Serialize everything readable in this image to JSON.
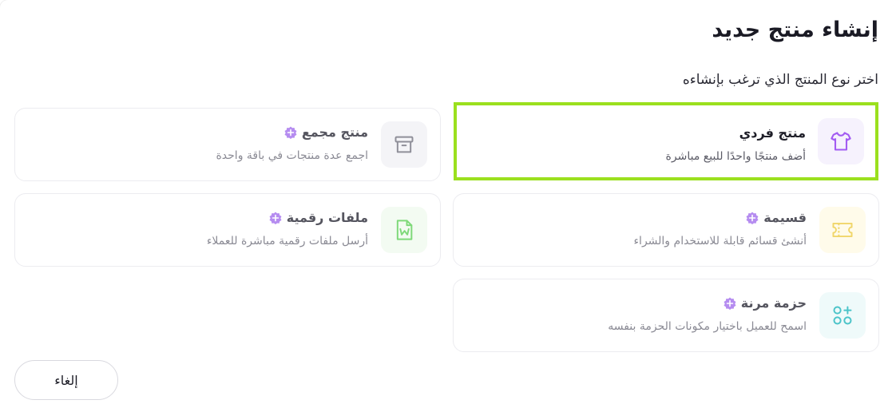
{
  "dialog": {
    "title": "إنشاء منتج جديد",
    "subtitle": "اختر نوع المنتج الذي ترغب بإنشاءه"
  },
  "options": [
    {
      "title": "منتج فردي",
      "description": "أضف منتجًا واحدًا للبيع مباشرة",
      "icon": "tshirt-icon",
      "selected": true,
      "badge": false
    },
    {
      "title": "منتج مجمع",
      "description": "اجمع عدة منتجات في باقة واحدة",
      "icon": "archive-box-icon",
      "selected": false,
      "badge": true
    },
    {
      "title": "قسيمة",
      "description": "أنشئ قسائم قابلة للاستخدام والشراء",
      "icon": "ticket-icon",
      "selected": false,
      "badge": true
    },
    {
      "title": "ملفات رقمية",
      "description": "أرسل ملفات رقمية مباشرة للعملاء",
      "icon": "document-icon",
      "selected": false,
      "badge": true
    },
    {
      "title": "حزمة مرنة",
      "description": "اسمح للعميل باختيار مكونات الحزمة بنفسه",
      "icon": "shapes-plus-icon",
      "selected": false,
      "badge": true
    }
  ],
  "footer": {
    "cancel_label": "إلغاء"
  },
  "colors": {
    "selected_border": "#9be01e",
    "badge": "#b58cf0",
    "tshirt_icon": "#a35cf2",
    "archive_icon": "#8f8f99",
    "ticket_icon": "#f0d66a",
    "document_icon": "#7fd97a",
    "shapes_icon": "#4cc4c9"
  }
}
